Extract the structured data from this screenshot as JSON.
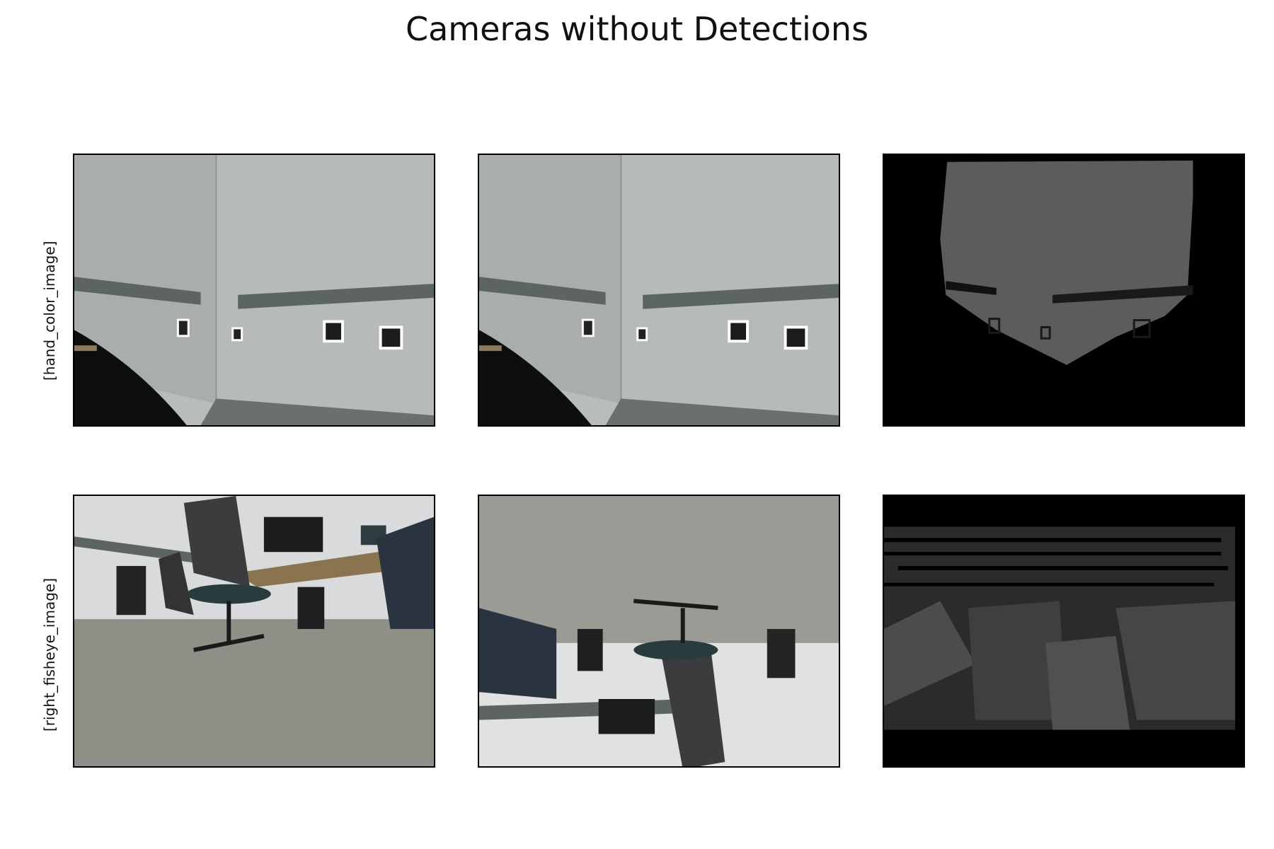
{
  "figure": {
    "title": "Cameras without Detections",
    "rows": [
      {
        "label": "[hand_color_image]"
      },
      {
        "label": "[right_fisheye_image]"
      }
    ]
  }
}
